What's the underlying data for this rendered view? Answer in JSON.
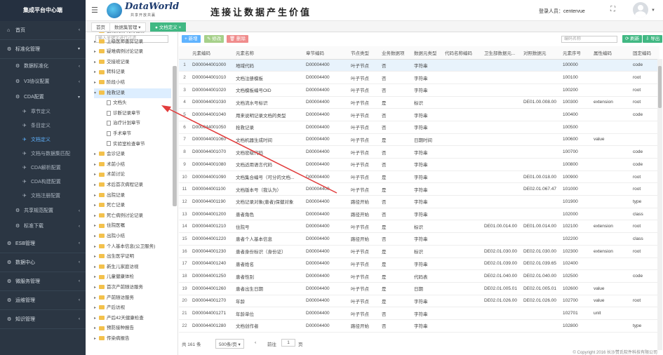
{
  "app": {
    "title": "集成平台中心端"
  },
  "header": {
    "logo_text": "DataWorld",
    "logo_sub": "共享开放共赢",
    "slogan": "连接让数据产生价值",
    "login_user": "登录人员：centervue"
  },
  "sidebar": [
    {
      "label": "首页",
      "level": 1,
      "icon": "home-icon"
    },
    {
      "label": "标准化管理",
      "level": 1,
      "icon": "gear-icon",
      "open": true
    },
    {
      "label": "数据标准化",
      "level": 2,
      "icon": "gear-icon"
    },
    {
      "label": "V3协议配置",
      "level": 2,
      "icon": "gear-icon"
    },
    {
      "label": "CDA配置",
      "level": 2,
      "icon": "gear-icon",
      "open": true
    },
    {
      "label": "章节定义",
      "level": 3,
      "icon": "plane-icon"
    },
    {
      "label": "条目定义",
      "level": 3,
      "icon": "plane-icon"
    },
    {
      "label": "文档定义",
      "level": 3,
      "icon": "plane-icon",
      "active": true
    },
    {
      "label": "文档与数据集匹配",
      "level": 3,
      "icon": "plane-icon"
    },
    {
      "label": "CDA解析配置",
      "level": 3,
      "icon": "plane-icon"
    },
    {
      "label": "CDA构建配置",
      "level": 3,
      "icon": "plane-icon"
    },
    {
      "label": "文档注册配置",
      "level": 3,
      "icon": "plane-icon"
    },
    {
      "label": "共享规范配置",
      "level": 2,
      "icon": "gear-icon"
    },
    {
      "label": "标准下载",
      "level": 2,
      "icon": "gear-icon"
    },
    {
      "label": "ESB管理",
      "level": 1,
      "icon": "gear-icon"
    },
    {
      "label": "数据中心",
      "level": 1,
      "icon": "gear-icon"
    },
    {
      "label": "微服务管理",
      "level": 1,
      "icon": "gear-icon"
    },
    {
      "label": "运维管理",
      "level": 1,
      "icon": "gear-icon"
    },
    {
      "label": "知识管理",
      "level": 1,
      "icon": "gear-icon"
    }
  ],
  "tabs": [
    {
      "label": "首页"
    },
    {
      "label": "数据集管理"
    },
    {
      "label": "文档定义",
      "active": true
    }
  ],
  "tree": {
    "search_placeholder": "输入关键字进行过滤",
    "nodes": [
      {
        "label": "器械试剂/耗材记录",
        "depth": 1,
        "type": "folder"
      },
      {
        "label": "上级医师查房记录",
        "depth": 1,
        "type": "folder"
      },
      {
        "label": "疑难病例讨论记录",
        "depth": 1,
        "type": "folder"
      },
      {
        "label": "交接班记录",
        "depth": 1,
        "type": "folder"
      },
      {
        "label": "转科记录",
        "depth": 1,
        "type": "folder"
      },
      {
        "label": "阶段小结",
        "depth": 1,
        "type": "folder"
      },
      {
        "label": "抢救记录",
        "depth": 1,
        "type": "folder",
        "open": true,
        "selected": true
      },
      {
        "label": "文档头",
        "depth": 2,
        "type": "doc"
      },
      {
        "label": "诊断记录章节",
        "depth": 2,
        "type": "doc"
      },
      {
        "label": "治疗计划章节",
        "depth": 2,
        "type": "doc"
      },
      {
        "label": "手术章节",
        "depth": 2,
        "type": "doc"
      },
      {
        "label": "实验室检查章节",
        "depth": 2,
        "type": "doc"
      },
      {
        "label": "会诊记录",
        "depth": 1,
        "type": "folder"
      },
      {
        "label": "术前小结",
        "depth": 1,
        "type": "folder"
      },
      {
        "label": "术前讨论",
        "depth": 1,
        "type": "folder"
      },
      {
        "label": "术后首次病程记录",
        "depth": 1,
        "type": "folder"
      },
      {
        "label": "出院记录",
        "depth": 1,
        "type": "folder"
      },
      {
        "label": "死亡记录",
        "depth": 1,
        "type": "folder"
      },
      {
        "label": "死亡病例讨论记录",
        "depth": 1,
        "type": "folder"
      },
      {
        "label": "住院医嘱",
        "depth": 1,
        "type": "folder"
      },
      {
        "label": "出院小结",
        "depth": 1,
        "type": "folder"
      },
      {
        "label": "个人基本信息(公卫服务)",
        "depth": 1,
        "type": "folder"
      },
      {
        "label": "出生医学证明",
        "depth": 1,
        "type": "folder"
      },
      {
        "label": "新生儿家庭访视",
        "depth": 1,
        "type": "folder"
      },
      {
        "label": "儿童健康体检",
        "depth": 1,
        "type": "folder"
      },
      {
        "label": "首次产前随访服务",
        "depth": 1,
        "type": "folder"
      },
      {
        "label": "产前随访服务",
        "depth": 1,
        "type": "folder"
      },
      {
        "label": "产后访视",
        "depth": 1,
        "type": "folder"
      },
      {
        "label": "产后42天健康检查",
        "depth": 1,
        "type": "folder"
      },
      {
        "label": "预防接种报告",
        "depth": 1,
        "type": "folder"
      },
      {
        "label": "传染病报告",
        "depth": 1,
        "type": "folder"
      }
    ]
  },
  "toolbar": {
    "add": "+ 新增",
    "edit": "✎ 修改",
    "delete": "🗑 删除",
    "search_placeholder": "编码名称",
    "refresh": "⟳ 刷新",
    "export": "⇩ 导出"
  },
  "table": {
    "columns": [
      "",
      "元素编码",
      "元素名称",
      "章节编码",
      "节点类型",
      "业务数据项",
      "数据元类型",
      "代码名称编码",
      "卫生部数据元...",
      "对照数据元",
      "元素序号",
      "属性编码",
      "固定编码"
    ],
    "rows": [
      [
        "1",
        "D000044001000",
        "地域代码",
        "D00004400",
        "叶子节点",
        "否",
        "字符串",
        "",
        "",
        "",
        "100000",
        "",
        "code"
      ],
      [
        "2",
        "D000044001010",
        "文档注册模板",
        "D00004400",
        "叶子节点",
        "否",
        "字符串",
        "",
        "",
        "",
        "100100",
        "",
        "root"
      ],
      [
        "3",
        "D000044001020",
        "文档模板编号OID",
        "D00004400",
        "叶子节点",
        "否",
        "字符串",
        "",
        "",
        "",
        "100200",
        "",
        "root"
      ],
      [
        "4",
        "D000044001030",
        "文档流水号标识",
        "D00004400",
        "叶子节点",
        "是",
        "标识",
        "",
        "",
        "DE01.00.008.00",
        "100300",
        "extension",
        "root"
      ],
      [
        "5",
        "D000044001040",
        "用来说明记录文档的类型",
        "D00004400",
        "叶子节点",
        "否",
        "字符串",
        "",
        "",
        "",
        "100400",
        "",
        "code"
      ],
      [
        "6",
        "D000044001050",
        "抢救记录",
        "D00004400",
        "叶子节点",
        "否",
        "字符串",
        "",
        "",
        "",
        "100500",
        "",
        ""
      ],
      [
        "7",
        "D000044001060",
        "文档机器生成时间",
        "D00004400",
        "叶子节点",
        "是",
        "日期时间",
        "",
        "",
        "",
        "100600",
        "value",
        ""
      ],
      [
        "8",
        "D000044001070",
        "文档密级代码",
        "D00004400",
        "叶子节点",
        "否",
        "字符串",
        "",
        "",
        "",
        "100700",
        "",
        "code"
      ],
      [
        "9",
        "D000044001080",
        "文档适用语言代码",
        "D00004400",
        "叶子节点",
        "否",
        "字符串",
        "",
        "",
        "",
        "100800",
        "",
        "code"
      ],
      [
        "10",
        "D000044001090",
        "文档集合编号（可分的文档...",
        "D00004400",
        "叶子节点",
        "是",
        "字符串",
        "",
        "",
        "DE01.00.018.00",
        "100900",
        "",
        "root"
      ],
      [
        "11",
        "D000044001100",
        "文档版本号（我认为）",
        "D00004400",
        "叶子节点",
        "是",
        "字符串",
        "",
        "",
        "DE02.01.067.47",
        "101000",
        "",
        "root"
      ],
      [
        "12",
        "D000044001190",
        "文档记录对象(患者)保健对象",
        "D00004400",
        "路径开始",
        "否",
        "字符串",
        "",
        "",
        "",
        "101900",
        "",
        "type"
      ],
      [
        "13",
        "D000044001200",
        "患者角色",
        "D00004400",
        "路径开始",
        "否",
        "字符串",
        "",
        "",
        "",
        "102000",
        "",
        "class"
      ],
      [
        "14",
        "D000044001210",
        "住院号",
        "D00004400",
        "叶子节点",
        "是",
        "标识",
        "",
        "DE01.00.014.00",
        "DE01.00.014.00",
        "102100",
        "extension",
        "root"
      ],
      [
        "15",
        "D000044001220",
        "患者个人基本信息",
        "D00004400",
        "路径开始",
        "否",
        "字符串",
        "",
        "",
        "",
        "102200",
        "",
        "class"
      ],
      [
        "16",
        "D000044001230",
        "患者身份标识（身份证）",
        "D00004400",
        "叶子节点",
        "是",
        "标识",
        "",
        "DE02.01.030.00",
        "DE02.01.030.00",
        "102300",
        "extension",
        "root"
      ],
      [
        "17",
        "D000044001240",
        "患者姓名",
        "D00004400",
        "叶子节点",
        "是",
        "字符串",
        "",
        "DE02.01.039.00",
        "DE02.01.039.65",
        "102400",
        "",
        ""
      ],
      [
        "18",
        "D000044001250",
        "患者性别",
        "D00004400",
        "叶子节点",
        "是",
        "代码表",
        "",
        "DE02.01.040.00",
        "DE02.01.040.00",
        "102500",
        "",
        "code"
      ],
      [
        "19",
        "D000044001260",
        "患者出生日期",
        "D00004400",
        "叶子节点",
        "是",
        "日期",
        "",
        "DE02.01.005.01",
        "DE02.01.005.01",
        "102600",
        "value",
        ""
      ],
      [
        "20",
        "D000044001270",
        "年龄",
        "D00004400",
        "叶子节点",
        "是",
        "字符串",
        "",
        "DE02.01.026.00",
        "DE02.01.026.00",
        "102700",
        "value",
        "root"
      ],
      [
        "21",
        "D000044001271",
        "年龄单位",
        "D00004400",
        "叶子节点",
        "否",
        "字符串",
        "",
        "",
        "",
        "102701",
        "unit",
        ""
      ],
      [
        "22",
        "D000044001280",
        "文档创作者",
        "D00004400",
        "路径开始",
        "否",
        "字符串",
        "",
        "",
        "",
        "102800",
        "",
        "type"
      ]
    ]
  },
  "pager": {
    "total": "共 161 条",
    "page_size": "500条/页",
    "prev": "前往",
    "page": "1",
    "page_suffix": "页"
  },
  "footer": {
    "copyright": "© Copyright 2016 长沙赞氏软件科技有限公司"
  }
}
